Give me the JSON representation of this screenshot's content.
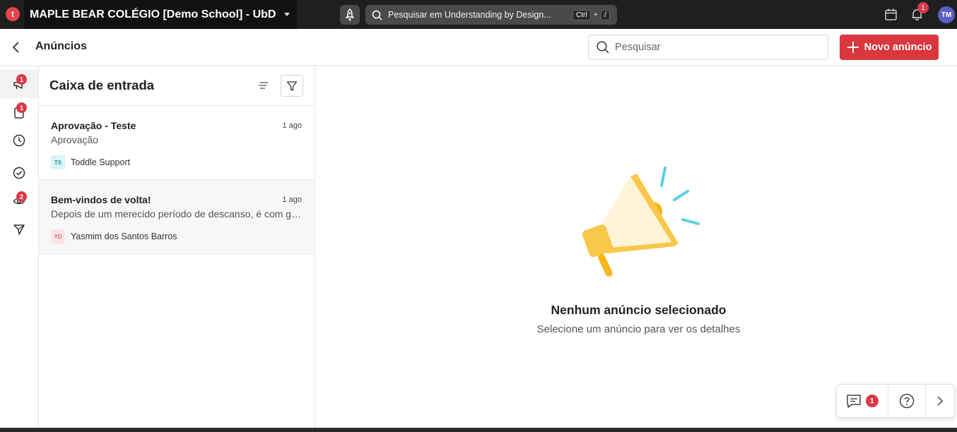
{
  "topbar": {
    "logo_letter": "t",
    "school_name": "MAPLE BEAR COLÉGIO [Demo School] - UbD",
    "search_text": "Pesquisar em Understanding by Design...",
    "shortcut_ctrl": "Ctrl",
    "shortcut_plus": "+",
    "shortcut_slash": "/",
    "notification_count": "1",
    "avatar_initials": "TM"
  },
  "header": {
    "title": "Anúncios",
    "search_placeholder": "Pesquisar",
    "new_button_label": "Novo anúncio"
  },
  "rail": {
    "items": [
      {
        "icon": "megaphone-icon",
        "badge": "1",
        "active": true
      },
      {
        "icon": "clipboard-icon",
        "badge": "1"
      },
      {
        "icon": "clock-icon",
        "badge": ""
      },
      {
        "icon": "check-circle-icon",
        "badge": ""
      },
      {
        "icon": "eye-icon",
        "badge": "2"
      },
      {
        "icon": "send-icon",
        "badge": ""
      }
    ]
  },
  "inbox": {
    "title": "Caixa de entrada",
    "items": [
      {
        "title": "Aprovação - Teste",
        "time": "1 ago",
        "preview": "Aprovação",
        "author_initials": "TS",
        "author": "Toddle Support"
      },
      {
        "title": "Bem-vindos de volta!",
        "time": "1 ago",
        "preview": "Depois de um merecido período de descanso, é com grande alegria que damos as boas-vindas",
        "author_initials": "YD",
        "author": "Yasmim dos Santos Barros"
      }
    ]
  },
  "empty_state": {
    "title": "Nenhum anúncio selecionado",
    "subtitle": "Selecione um anúncio para ver os detalhes"
  },
  "helper": {
    "chat_count": "1"
  },
  "colors": {
    "accent": "#d9363e",
    "topbar": "#1f1f1f",
    "avatar": "#5b5fc7",
    "megaphone": "#f9c84a"
  }
}
